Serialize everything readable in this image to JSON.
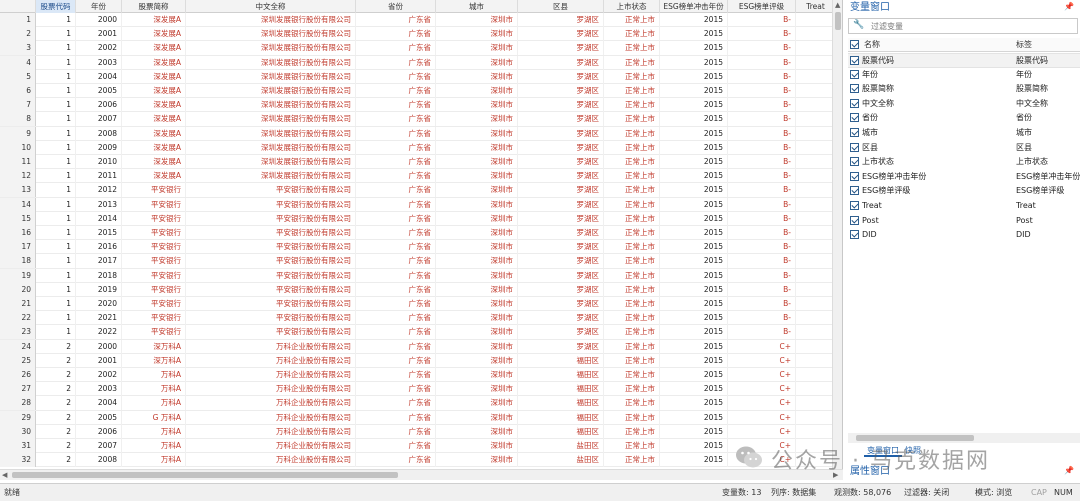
{
  "grid": {
    "columns": [
      "股票代码",
      "年份",
      "股票简称",
      "中文全称",
      "省份",
      "城市",
      "区县",
      "上市状态",
      "ESG榜单冲击年份",
      "ESG榜单评级",
      "Treat"
    ],
    "rows": [
      {
        "n": "1",
        "code": "1",
        "year": "2000",
        "short": "深发展A",
        "full": "深圳发展银行股份有限公司",
        "prov": "广东省",
        "city": "深圳市",
        "dist": "罗湖区",
        "status": "正常上市",
        "esgyear": "2015",
        "grade": "B-"
      },
      {
        "n": "2",
        "code": "1",
        "year": "2001",
        "short": "深发展A",
        "full": "深圳发展银行股份有限公司",
        "prov": "广东省",
        "city": "深圳市",
        "dist": "罗湖区",
        "status": "正常上市",
        "esgyear": "2015",
        "grade": "B-"
      },
      {
        "n": "3",
        "code": "1",
        "year": "2002",
        "short": "深发展A",
        "full": "深圳发展银行股份有限公司",
        "prov": "广东省",
        "city": "深圳市",
        "dist": "罗湖区",
        "status": "正常上市",
        "esgyear": "2015",
        "grade": "B-"
      },
      {
        "n": "4",
        "code": "1",
        "year": "2003",
        "short": "深发展A",
        "full": "深圳发展银行股份有限公司",
        "prov": "广东省",
        "city": "深圳市",
        "dist": "罗湖区",
        "status": "正常上市",
        "esgyear": "2015",
        "grade": "B-"
      },
      {
        "n": "5",
        "code": "1",
        "year": "2004",
        "short": "深发展A",
        "full": "深圳发展银行股份有限公司",
        "prov": "广东省",
        "city": "深圳市",
        "dist": "罗湖区",
        "status": "正常上市",
        "esgyear": "2015",
        "grade": "B-"
      },
      {
        "n": "6",
        "code": "1",
        "year": "2005",
        "short": "深发展A",
        "full": "深圳发展银行股份有限公司",
        "prov": "广东省",
        "city": "深圳市",
        "dist": "罗湖区",
        "status": "正常上市",
        "esgyear": "2015",
        "grade": "B-"
      },
      {
        "n": "7",
        "code": "1",
        "year": "2006",
        "short": "深发展A",
        "full": "深圳发展银行股份有限公司",
        "prov": "广东省",
        "city": "深圳市",
        "dist": "罗湖区",
        "status": "正常上市",
        "esgyear": "2015",
        "grade": "B-"
      },
      {
        "n": "8",
        "code": "1",
        "year": "2007",
        "short": "深发展A",
        "full": "深圳发展银行股份有限公司",
        "prov": "广东省",
        "city": "深圳市",
        "dist": "罗湖区",
        "status": "正常上市",
        "esgyear": "2015",
        "grade": "B-"
      },
      {
        "n": "9",
        "code": "1",
        "year": "2008",
        "short": "深发展A",
        "full": "深圳发展银行股份有限公司",
        "prov": "广东省",
        "city": "深圳市",
        "dist": "罗湖区",
        "status": "正常上市",
        "esgyear": "2015",
        "grade": "B-"
      },
      {
        "n": "10",
        "code": "1",
        "year": "2009",
        "short": "深发展A",
        "full": "深圳发展银行股份有限公司",
        "prov": "广东省",
        "city": "深圳市",
        "dist": "罗湖区",
        "status": "正常上市",
        "esgyear": "2015",
        "grade": "B-"
      },
      {
        "n": "11",
        "code": "1",
        "year": "2010",
        "short": "深发展A",
        "full": "深圳发展银行股份有限公司",
        "prov": "广东省",
        "city": "深圳市",
        "dist": "罗湖区",
        "status": "正常上市",
        "esgyear": "2015",
        "grade": "B-"
      },
      {
        "n": "12",
        "code": "1",
        "year": "2011",
        "short": "深发展A",
        "full": "深圳发展银行股份有限公司",
        "prov": "广东省",
        "city": "深圳市",
        "dist": "罗湖区",
        "status": "正常上市",
        "esgyear": "2015",
        "grade": "B-"
      },
      {
        "n": "13",
        "code": "1",
        "year": "2012",
        "short": "平安银行",
        "full": "平安银行股份有限公司",
        "prov": "广东省",
        "city": "深圳市",
        "dist": "罗湖区",
        "status": "正常上市",
        "esgyear": "2015",
        "grade": "B-"
      },
      {
        "n": "14",
        "code": "1",
        "year": "2013",
        "short": "平安银行",
        "full": "平安银行股份有限公司",
        "prov": "广东省",
        "city": "深圳市",
        "dist": "罗湖区",
        "status": "正常上市",
        "esgyear": "2015",
        "grade": "B-"
      },
      {
        "n": "15",
        "code": "1",
        "year": "2014",
        "short": "平安银行",
        "full": "平安银行股份有限公司",
        "prov": "广东省",
        "city": "深圳市",
        "dist": "罗湖区",
        "status": "正常上市",
        "esgyear": "2015",
        "grade": "B-"
      },
      {
        "n": "16",
        "code": "1",
        "year": "2015",
        "short": "平安银行",
        "full": "平安银行股份有限公司",
        "prov": "广东省",
        "city": "深圳市",
        "dist": "罗湖区",
        "status": "正常上市",
        "esgyear": "2015",
        "grade": "B-"
      },
      {
        "n": "17",
        "code": "1",
        "year": "2016",
        "short": "平安银行",
        "full": "平安银行股份有限公司",
        "prov": "广东省",
        "city": "深圳市",
        "dist": "罗湖区",
        "status": "正常上市",
        "esgyear": "2015",
        "grade": "B-"
      },
      {
        "n": "18",
        "code": "1",
        "year": "2017",
        "short": "平安银行",
        "full": "平安银行股份有限公司",
        "prov": "广东省",
        "city": "深圳市",
        "dist": "罗湖区",
        "status": "正常上市",
        "esgyear": "2015",
        "grade": "B-"
      },
      {
        "n": "19",
        "code": "1",
        "year": "2018",
        "short": "平安银行",
        "full": "平安银行股份有限公司",
        "prov": "广东省",
        "city": "深圳市",
        "dist": "罗湖区",
        "status": "正常上市",
        "esgyear": "2015",
        "grade": "B-"
      },
      {
        "n": "20",
        "code": "1",
        "year": "2019",
        "short": "平安银行",
        "full": "平安银行股份有限公司",
        "prov": "广东省",
        "city": "深圳市",
        "dist": "罗湖区",
        "status": "正常上市",
        "esgyear": "2015",
        "grade": "B-"
      },
      {
        "n": "21",
        "code": "1",
        "year": "2020",
        "short": "平安银行",
        "full": "平安银行股份有限公司",
        "prov": "广东省",
        "city": "深圳市",
        "dist": "罗湖区",
        "status": "正常上市",
        "esgyear": "2015",
        "grade": "B-"
      },
      {
        "n": "22",
        "code": "1",
        "year": "2021",
        "short": "平安银行",
        "full": "平安银行股份有限公司",
        "prov": "广东省",
        "city": "深圳市",
        "dist": "罗湖区",
        "status": "正常上市",
        "esgyear": "2015",
        "grade": "B-"
      },
      {
        "n": "23",
        "code": "1",
        "year": "2022",
        "short": "平安银行",
        "full": "平安银行股份有限公司",
        "prov": "广东省",
        "city": "深圳市",
        "dist": "罗湖区",
        "status": "正常上市",
        "esgyear": "2015",
        "grade": "B-"
      },
      {
        "n": "24",
        "code": "2",
        "year": "2000",
        "short": "深万科A",
        "full": "万科企业股份有限公司",
        "prov": "广东省",
        "city": "深圳市",
        "dist": "罗湖区",
        "status": "正常上市",
        "esgyear": "2015",
        "grade": "C+"
      },
      {
        "n": "25",
        "code": "2",
        "year": "2001",
        "short": "深万科A",
        "full": "万科企业股份有限公司",
        "prov": "广东省",
        "city": "深圳市",
        "dist": "福田区",
        "status": "正常上市",
        "esgyear": "2015",
        "grade": "C+"
      },
      {
        "n": "26",
        "code": "2",
        "year": "2002",
        "short": "万科A",
        "full": "万科企业股份有限公司",
        "prov": "广东省",
        "city": "深圳市",
        "dist": "福田区",
        "status": "正常上市",
        "esgyear": "2015",
        "grade": "C+"
      },
      {
        "n": "27",
        "code": "2",
        "year": "2003",
        "short": "万科A",
        "full": "万科企业股份有限公司",
        "prov": "广东省",
        "city": "深圳市",
        "dist": "福田区",
        "status": "正常上市",
        "esgyear": "2015",
        "grade": "C+"
      },
      {
        "n": "28",
        "code": "2",
        "year": "2004",
        "short": "万科A",
        "full": "万科企业股份有限公司",
        "prov": "广东省",
        "city": "深圳市",
        "dist": "福田区",
        "status": "正常上市",
        "esgyear": "2015",
        "grade": "C+"
      },
      {
        "n": "29",
        "code": "2",
        "year": "2005",
        "short": "G 万科A",
        "full": "万科企业股份有限公司",
        "prov": "广东省",
        "city": "深圳市",
        "dist": "福田区",
        "status": "正常上市",
        "esgyear": "2015",
        "grade": "C+"
      },
      {
        "n": "30",
        "code": "2",
        "year": "2006",
        "short": "万科A",
        "full": "万科企业股份有限公司",
        "prov": "广东省",
        "city": "深圳市",
        "dist": "福田区",
        "status": "正常上市",
        "esgyear": "2015",
        "grade": "C+"
      },
      {
        "n": "31",
        "code": "2",
        "year": "2007",
        "short": "万科A",
        "full": "万科企业股份有限公司",
        "prov": "广东省",
        "city": "深圳市",
        "dist": "盐田区",
        "status": "正常上市",
        "esgyear": "2015",
        "grade": "C+"
      },
      {
        "n": "32",
        "code": "2",
        "year": "2008",
        "short": "万科A",
        "full": "万科企业股份有限公司",
        "prov": "广东省",
        "city": "深圳市",
        "dist": "盐田区",
        "status": "正常上市",
        "esgyear": "2015",
        "grade": "C+"
      }
    ]
  },
  "variables_window": {
    "title": "变量窗口",
    "pin_icon": "pin-icon",
    "filter_placeholder": "过滤变量",
    "header_name": "名称",
    "header_label": "标签",
    "variables": [
      {
        "name": "股票代码",
        "label": "股票代码"
      },
      {
        "name": "年份",
        "label": "年份"
      },
      {
        "name": "股票简称",
        "label": "股票简称"
      },
      {
        "name": "中文全称",
        "label": "中文全称"
      },
      {
        "name": "省份",
        "label": "省份"
      },
      {
        "name": "城市",
        "label": "城市"
      },
      {
        "name": "区县",
        "label": "区县"
      },
      {
        "name": "上市状态",
        "label": "上市状态"
      },
      {
        "name": "ESG榜单冲击年份",
        "label": "ESG榜单冲击年份"
      },
      {
        "name": "ESG榜单评级",
        "label": "ESG榜单评级"
      },
      {
        "name": "Treat",
        "label": "Treat"
      },
      {
        "name": "Post",
        "label": "Post"
      },
      {
        "name": "DID",
        "label": "DID"
      }
    ],
    "tabs": [
      "变量窗口",
      "快照"
    ]
  },
  "properties_window": {
    "title": "属性窗口"
  },
  "watermark": {
    "text": "公众号 · 马克数据网"
  },
  "statusbar": {
    "ready": "就绪",
    "var_count": "变量数: 13",
    "order": "列序: 数据集",
    "obs": "观测数: 58,076",
    "filter": "过滤器: 关闭",
    "mode": "模式: 浏览",
    "cap": "CAP",
    "num": "NUM"
  },
  "colors": {
    "accent": "#1f5fa8",
    "string_value": "#c0392b"
  }
}
